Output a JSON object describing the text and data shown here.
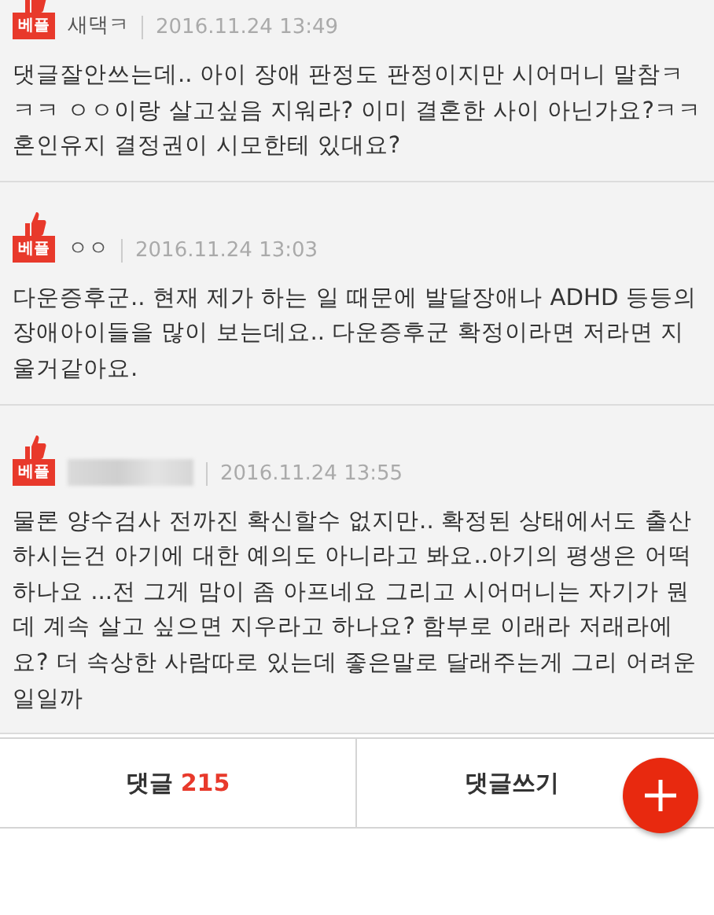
{
  "comments": [
    {
      "badge": "베플",
      "author": "새댁ㅋ",
      "author_blurred": false,
      "time": "2016.11.24 13:49",
      "body": "댓글잘안쓰는데.. 아이 장애 판정도 판정이지만 시어머니 말참ㅋㅋㅋ ㅇㅇ이랑 살고싶음 지워라? 이미 결혼한 사이 아닌가요?ㅋㅋ 혼인유지 결정권이 시모한테 있대요?"
    },
    {
      "badge": "베플",
      "author": "ㅇㅇ",
      "author_blurred": false,
      "time": "2016.11.24 13:03",
      "body": "다운증후군.. 현재 제가 하는 일 때문에 발달장애나 ADHD 등등의 장애아이들을 많이 보는데요.. 다운증후군 확정이라면 저라면 지울거같아요."
    },
    {
      "badge": "베플",
      "author_blurred": true,
      "time": "2016.11.24 13:55",
      "body": "물론 양수검사 전까진 확신할수 없지만.. 확정된 상태에서도 출산하시는건 아기에 대한 예의도 아니라고 봐요..아기의 평생은 어떡하나요 ...전 그게 맘이 좀 아프네요 그리고 시어머니는 자기가 뭔데 계속 살고 싶으면 지우라고 하나요? 함부로 이래라 저래라에요? 더 속상한 사람따로 있는데 좋은말로 달래주는게 그리 어려운 일일까"
    }
  ],
  "footer": {
    "comments_label": "댓글",
    "comment_count": "215",
    "write_label": "댓글쓰기"
  }
}
